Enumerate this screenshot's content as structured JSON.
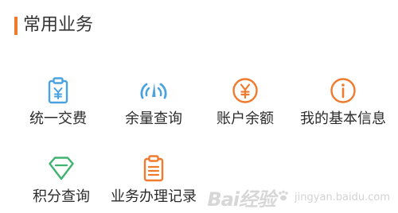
{
  "section": {
    "title": "常用业务",
    "accent_color": "#f07a2e"
  },
  "services": [
    {
      "label": "统一交费",
      "icon": "clipboard-yen-icon",
      "color": "#4aa3df"
    },
    {
      "label": "余量查询",
      "icon": "gauge-icon",
      "color": "#4aa3df"
    },
    {
      "label": "账户余额",
      "icon": "yen-circle-icon",
      "color": "#f07a2e"
    },
    {
      "label": "我的基本信息",
      "icon": "info-circle-icon",
      "color": "#f07a2e"
    },
    {
      "label": "积分查询",
      "icon": "diamond-icon",
      "color": "#3fb36e"
    },
    {
      "label": "业务办理记录",
      "icon": "clipboard-list-icon",
      "color": "#f07a2e"
    }
  ],
  "watermark": {
    "brand": "Bai经验",
    "site": "jingyan.baidu.com"
  }
}
